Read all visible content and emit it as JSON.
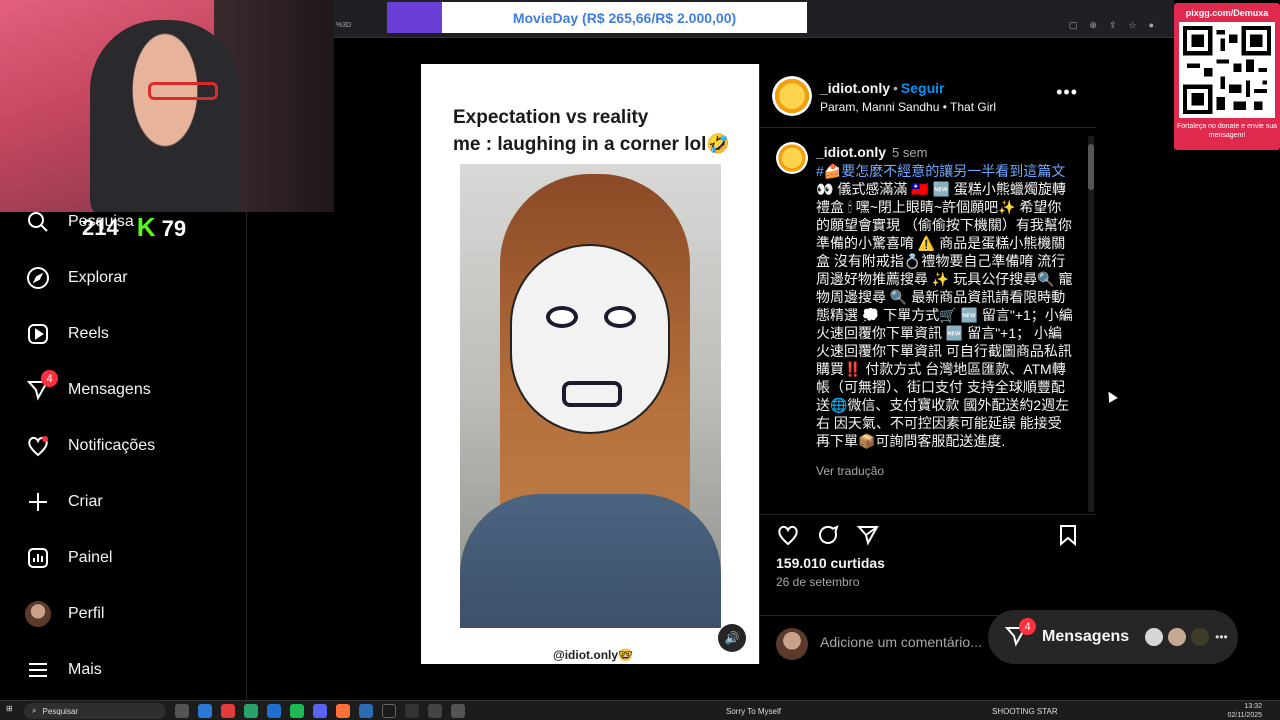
{
  "stream": {
    "donation": "MovieDay (R$ 265,66/R$ 2.000,00)",
    "twitch_viewers": "214",
    "kick_viewers": "79",
    "kick_logo": "K",
    "qr_url": "pixgg.com/Demuxa",
    "qr_message": "Fortaleça no donate e envie sua mensagem!",
    "url_fragment": "%3D"
  },
  "sidebar": {
    "items": [
      {
        "label": "Pesquisa",
        "icon": "search-icon"
      },
      {
        "label": "Explorar",
        "icon": "compass-icon"
      },
      {
        "label": "Reels",
        "icon": "reels-icon"
      },
      {
        "label": "Mensagens",
        "icon": "messenger-icon",
        "badge": "4"
      },
      {
        "label": "Notificações",
        "icon": "heart-icon"
      },
      {
        "label": "Criar",
        "icon": "plus-icon"
      },
      {
        "label": "Painel",
        "icon": "chart-icon"
      },
      {
        "label": "Perfil",
        "icon": "avatar"
      },
      {
        "label": "Mais",
        "icon": "menu-icon"
      }
    ]
  },
  "post": {
    "caption_line1": "Expectation vs reality",
    "caption_line2": "me : laughing in a corner lol🤣",
    "watermark": "@idiot.only🤓",
    "username": "_idiot.only",
    "dot": "•",
    "follow": "Seguir",
    "audio": "Param, Manni Sandhu • That Girl",
    "more": "•••",
    "comment_user": "_idiot.only",
    "comment_time": "5 sem",
    "hashtag": "#🍰要怎麼不經意的讓另一半看到這篇文",
    "comment_body": "👀 儀式感滿滿 🇹🇼 🆕 蛋糕小熊蠟燭旋轉禮盒 🕯 嘿~閉上眼睛~許個願吧✨ 希望你的願望會實現 （偷偷按下機關）有我幫你準備的小驚喜唷 ⚠️ 商品是蛋糕小熊機關盒 沒有附戒指💍禮物要自己準備唷 流行周邊好物推薦搜尋 ✨ 玩具公仔搜尋🔍 寵物周邊搜尋 🔍 最新商品資訊請看限時動態精選 💭 下單方式🛒 🆕 留言\"+1；小編火速回覆你下單資訊 🆕 留言\"+1； 小編火速回覆你下單資訊 可自行截圖商品私訊購買‼️ 付款方式 台灣地區匯款、ATM轉帳（可無摺）、街口支付 支持全球順豐配送🌐微信、支付寶收款 國外配送約2週左右 因天氣、不可控因素可能延誤 能接受再下單📦可詢問客服配送進度.",
    "translate": "Ver tradução",
    "likes": "159.010 curtidas",
    "date": "26 de setembro",
    "comment_placeholder": "Adicione um comentário...",
    "mute_icon": "speaker-icon"
  },
  "messages_pill": {
    "label": "Mensagens",
    "badge": "4",
    "more": "•••"
  },
  "taskbar": {
    "search": "Pesquisar",
    "song": "Sorry To Myself",
    "song2": "SHOOTING STAR",
    "time": "13:32",
    "date": "02/11/2025"
  },
  "colors": {
    "accent_blue": "#0095f6",
    "badge_red": "#ff3040",
    "kick_green": "#53fc18",
    "donation_purple": "#6a3fd6",
    "qr_red": "#e02a4d"
  }
}
